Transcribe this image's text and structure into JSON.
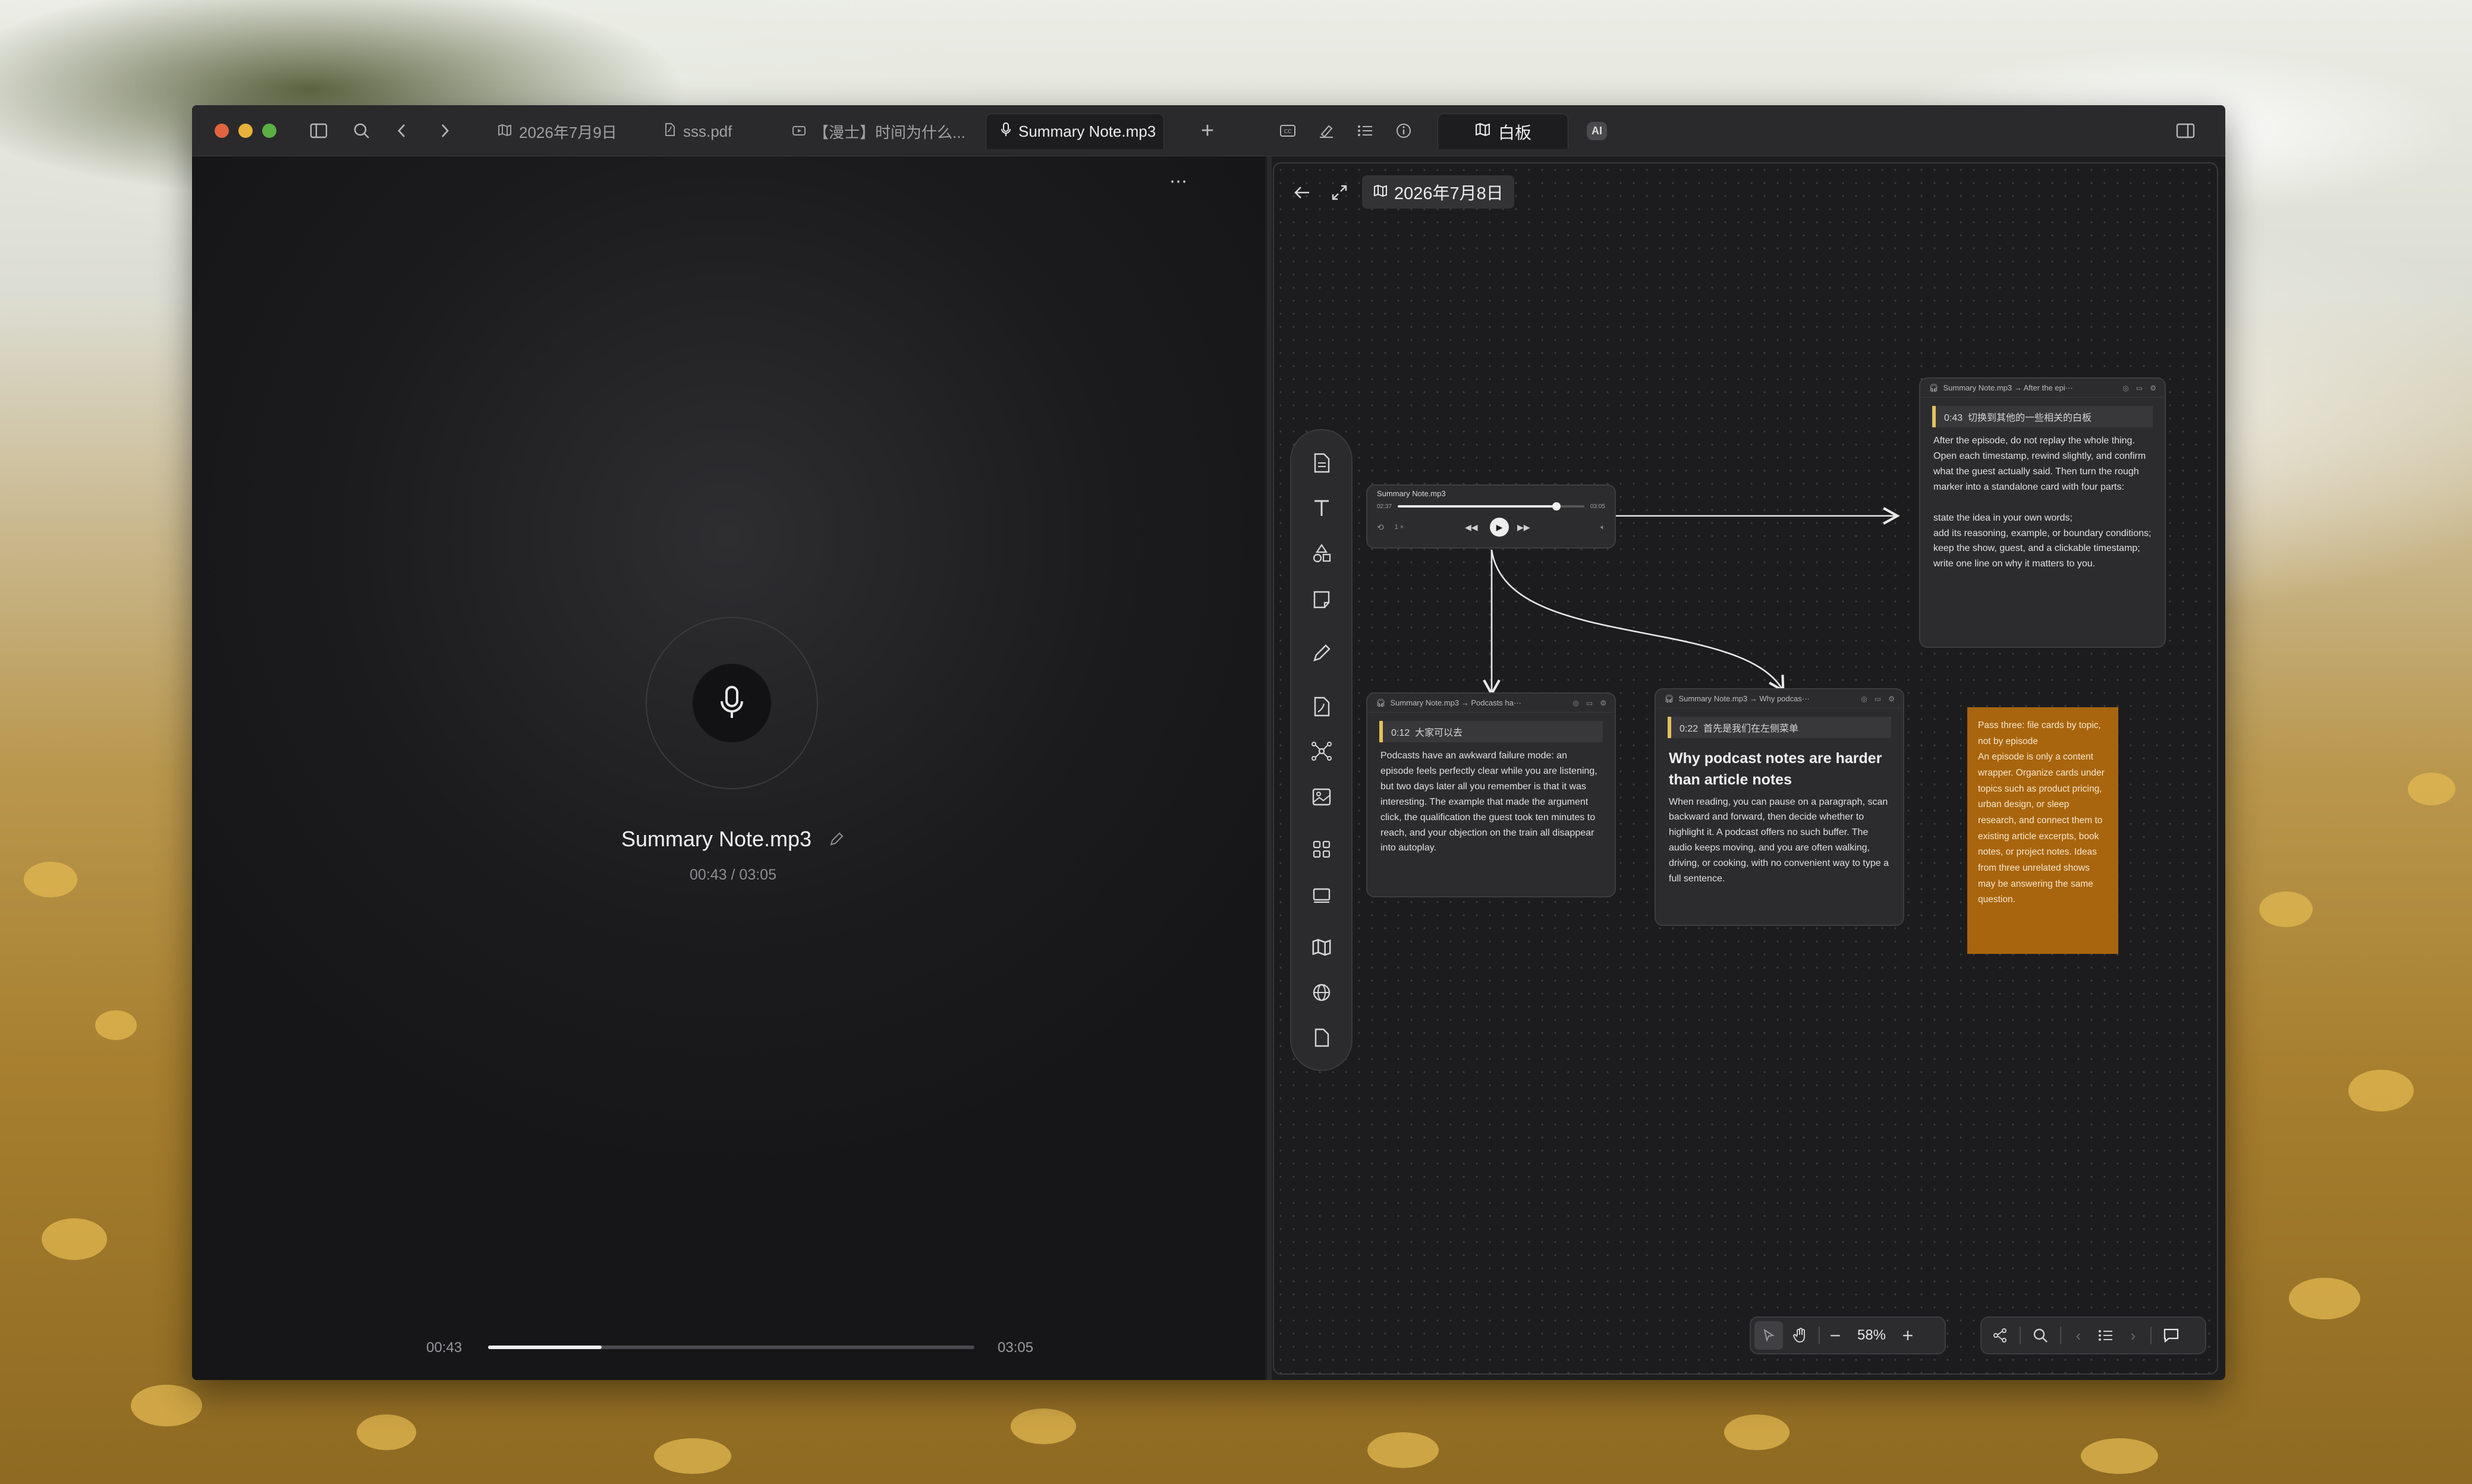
{
  "tabs": [
    {
      "label": "2026年7月9日",
      "icon": "map-icon"
    },
    {
      "label": "sss.pdf",
      "icon": "pdf-file-icon"
    },
    {
      "label": "【漫士】时间为什么...",
      "icon": "video-icon"
    },
    {
      "label": "Summary Note.mp3",
      "icon": "microphone-icon",
      "active": true
    }
  ],
  "toolbar_right": {
    "whiteboard_label": "白板",
    "ai_label": "AI"
  },
  "player": {
    "title": "Summary Note.mp3",
    "time_display": "00:43 / 03:05",
    "current_time": "00:43",
    "duration": "03:05",
    "progress": 0.233,
    "speed_label": "1×"
  },
  "whiteboard": {
    "breadcrumb": "2026年7月8日",
    "zoom": "58%",
    "audio_node": {
      "title": "Summary Note.mp3",
      "time_current": "02:37",
      "time_total": "03:05",
      "progress": 0.85,
      "speed": "1 ×"
    },
    "node_after": {
      "header": "Summary Note.mp3 → After the epi···",
      "timestamp": "0:43",
      "quote": "切换到其他的一些相关的白板",
      "intro": "After the episode, do not replay the whole thing. Open each timestamp, rewind slightly, and confirm what the guest actually said. Then turn the rough marker into a standalone card with four parts:",
      "items": [
        "state the idea in your own words;",
        "add its reasoning, example, or boundary conditions;",
        "keep the show, guest, and a clickable timestamp;",
        "write one line on why it matters to you."
      ]
    },
    "node_podcasts": {
      "header": "Summary Note.mp3 → Podcasts ha···",
      "timestamp": "0:12",
      "quote": "大家可以去",
      "body": "Podcasts have an awkward failure mode: an episode feels perfectly clear while you are listening, but two days later all you remember is that it was interesting. The example that made the argument click, the qualification the guest took ten minutes to reach, and your objection on the train all disappear into autoplay."
    },
    "node_why": {
      "header": "Summary Note.mp3 → Why podcas···",
      "timestamp": "0:22",
      "quote": "首先是我们在左侧菜单",
      "heading": "Why podcast notes are harder than article notes",
      "body": "When reading, you can pause on a paragraph, scan backward and forward, then decide whether to highlight it. A podcast offers no such buffer. The audio keeps moving, and you are often walking, driving, or cooking, with no convenient way to type a full sentence."
    },
    "sticky": {
      "color": "#a8650e",
      "title": "Pass three: file cards by topic, not by episode",
      "body": "An episode is only a content wrapper. Organize cards under topics such as product pricing, urban design, or sleep research, and connect them to existing article excerpts, book notes, or project notes. Ideas from three unrelated shows may be answering the same question."
    }
  },
  "colors": {
    "accent_yellow": "#e2c15b",
    "sticky": "#a8650e",
    "window_bg": "#1d1d1f"
  }
}
